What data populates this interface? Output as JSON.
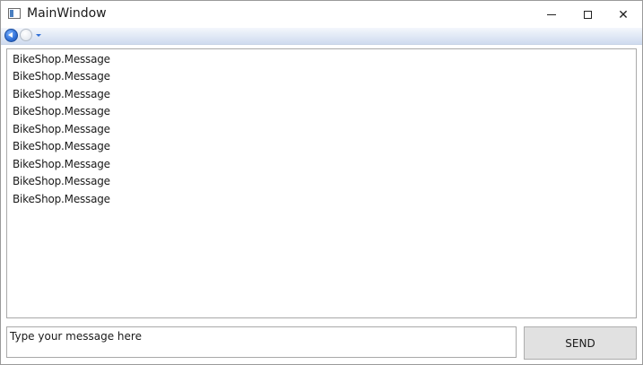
{
  "window": {
    "title": "MainWindow",
    "icon": "window-app-icon",
    "controls": {
      "minimize_icon": "minimize-icon",
      "maximize_icon": "maximize-icon",
      "close_glyph": "✕"
    }
  },
  "navigation": {
    "back_icon": "back-arrow-icon",
    "forward_icon": "forward-arrow-icon",
    "history_icon": "history-dropdown-icon"
  },
  "messages": [
    "BikeShop.Message",
    "BikeShop.Message",
    "BikeShop.Message",
    "BikeShop.Message",
    "BikeShop.Message",
    "BikeShop.Message",
    "BikeShop.Message",
    "BikeShop.Message",
    "BikeShop.Message"
  ],
  "composer": {
    "placeholder": "Type your message here",
    "value": "",
    "send_label": "SEND"
  }
}
